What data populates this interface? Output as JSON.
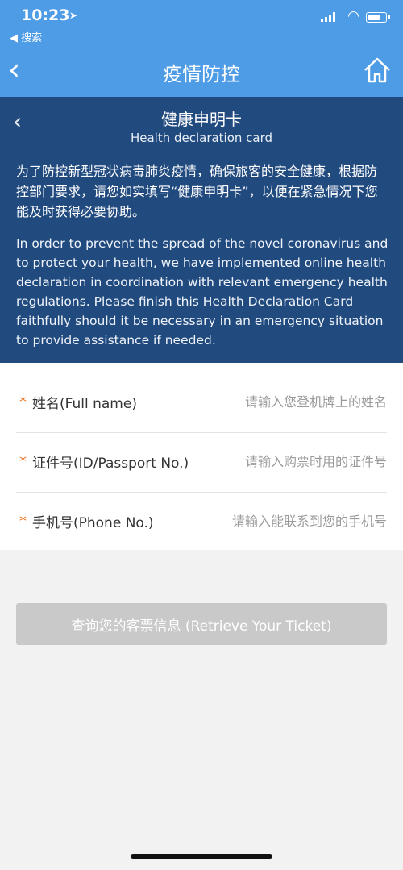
{
  "status_bar": {
    "time": "10:23",
    "back_app": "◀ 搜索"
  },
  "nav": {
    "title": "疫情防控"
  },
  "card": {
    "title": "健康申明卡",
    "subtitle": "Health declaration card",
    "intro_cn": "为了防控新型冠状病毒肺炎疫情，确保旅客的安全健康，根据防控部门要求，请您如实填写“健康申明卡”，以便在紧急情况下您能及时获得必要协助。",
    "intro_en": "In order to prevent the spread of the novel coronavirus and to protect your health, we have implemented online health declaration in coordination with relevant emergency health regulations. Please finish this Health Declaration Card faithfully should it be necessary in an emergency situation to provide assistance if needed."
  },
  "form": {
    "required_mark": "*",
    "fields": [
      {
        "label": "姓名(Full name)",
        "placeholder": "请输入您登机牌上的姓名"
      },
      {
        "label": "证件号(ID/Passport No.)",
        "placeholder": "请输入购票时用的证件号"
      },
      {
        "label": "手机号(Phone No.)",
        "placeholder": "请输入能联系到您的手机号"
      }
    ]
  },
  "actions": {
    "retrieve_label": "查询您的客票信息 (Retrieve Your Ticket)"
  },
  "colors": {
    "header_blue": "#4e9be6",
    "banner_navy": "#214a7f",
    "required_orange": "#e8731e",
    "button_disabled_gray": "#c9c9c9"
  }
}
